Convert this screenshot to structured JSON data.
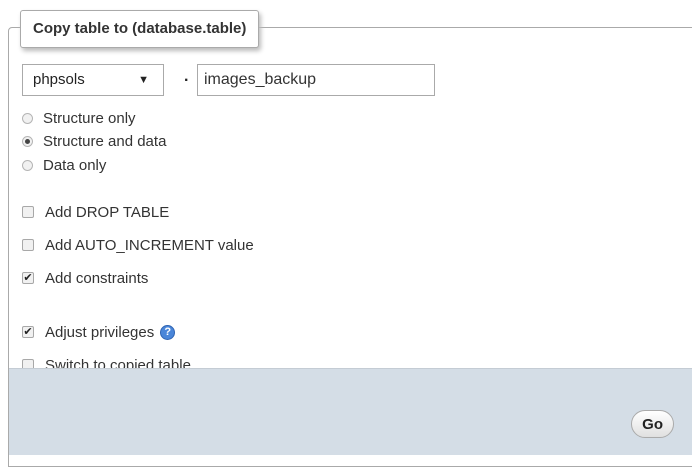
{
  "fieldset": {
    "legend": "Copy table to (database.table)"
  },
  "target": {
    "database_selected": "phpsols",
    "separator": ".",
    "table_value": "images_backup"
  },
  "mode_options": [
    {
      "label": "Structure only",
      "selected": false
    },
    {
      "label": "Structure and data",
      "selected": true
    },
    {
      "label": "Data only",
      "selected": false
    }
  ],
  "checkboxes": {
    "add_drop_table": {
      "label": "Add DROP TABLE",
      "checked": false
    },
    "add_auto_increment": {
      "label": "Add AUTO_INCREMENT value",
      "checked": false
    },
    "add_constraints": {
      "label": "Add constraints",
      "checked": true
    },
    "adjust_privileges": {
      "label": "Adjust privileges",
      "checked": true
    },
    "switch_to_copied": {
      "label": "Switch to copied table",
      "checked": false
    }
  },
  "icons": {
    "select_arrow": "chevron-down-icon",
    "help": "help-icon"
  },
  "footer": {
    "go_label": "Go",
    "background_color": "#d4dde6"
  }
}
